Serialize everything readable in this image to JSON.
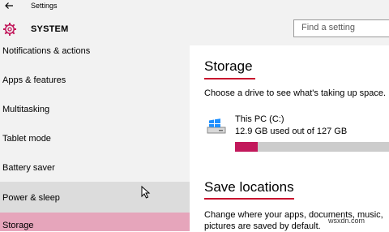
{
  "app": {
    "title": "Settings"
  },
  "header": {
    "section": "SYSTEM",
    "search_placeholder": "Find a setting"
  },
  "sidebar": {
    "items": [
      {
        "label": "Notifications & actions",
        "state": "normal"
      },
      {
        "label": "Apps & features",
        "state": "normal"
      },
      {
        "label": "Multitasking",
        "state": "normal"
      },
      {
        "label": "Tablet mode",
        "state": "normal"
      },
      {
        "label": "Battery saver",
        "state": "normal"
      },
      {
        "label": "Power & sleep",
        "state": "hover"
      },
      {
        "label": "Storage",
        "state": "selected"
      }
    ]
  },
  "storage": {
    "heading": "Storage",
    "description": "Choose a drive to see what's taking up space.",
    "drive": {
      "name": "This PC (C:)",
      "usage": "12.9 GB used out of 127 GB",
      "used_fraction": 0.1
    }
  },
  "save_locations": {
    "heading": "Save locations",
    "description": "Change where your apps, documents, music, pictures are saved by default."
  },
  "watermark": "wsxdn.com",
  "colors": {
    "accent": "#c8102e",
    "selected_bg": "#e6a5bb",
    "usage_bar": "#c2185b",
    "sidebar_bg": "#f2f2f2"
  }
}
